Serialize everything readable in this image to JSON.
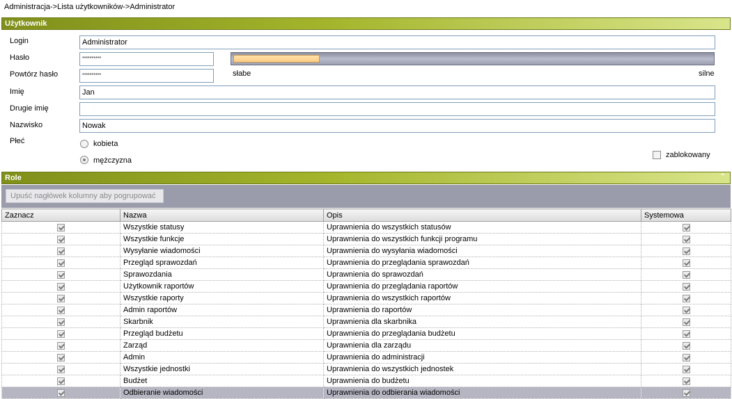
{
  "breadcrumb": "Administracja->Lista  użytkowników->Administrator",
  "user_section": {
    "title": "Użytkownik",
    "login_label": "Login",
    "login_value": "Administrator",
    "password_label": "Hasło",
    "password_value": "**********",
    "repeat_password_label": "Powtórz hasło",
    "repeat_password_value": "**********",
    "strength_weak_label": "słabe",
    "strength_strong_label": "silne",
    "strength_level": 0.18,
    "first_name_label": "Imię",
    "first_name_value": "Jan",
    "second_name_label": "Drugie imię",
    "second_name_value": "",
    "last_name_label": "Nazwisko",
    "last_name_value": "Nowak",
    "gender_label": "Płeć",
    "gender_female_label": "kobieta",
    "gender_male_label": "mężczyzna",
    "gender_selected": "male",
    "blocked_label": "zablokowany",
    "blocked_checked": false
  },
  "roles_section": {
    "title": "Role",
    "group_hint": "Upuść nagłówek kolumny aby pogrupować",
    "columns": [
      "Zaznacz",
      "Nazwa",
      "Opis",
      "Systemowa"
    ],
    "rows": [
      {
        "checked": true,
        "name": "Wszystkie statusy",
        "desc": "Uprawnienia do wszystkich statusów",
        "system": true
      },
      {
        "checked": true,
        "name": "Wszystkie funkcje",
        "desc": "Uprawnienia do wszystkich funkcji programu",
        "system": true
      },
      {
        "checked": true,
        "name": "Wysyłanie wiadomości",
        "desc": "Uprawnienia do wysyłania wiadomości",
        "system": true
      },
      {
        "checked": true,
        "name": "Przegląd sprawozdań",
        "desc": "Uprawnienia do przeglądania sprawozdań",
        "system": true
      },
      {
        "checked": true,
        "name": "Sprawozdania",
        "desc": "Uprawnienia do sprawozdań",
        "system": true
      },
      {
        "checked": true,
        "name": "Użytkownik raportów",
        "desc": "Uprawnienia do przeglądania raportów",
        "system": true
      },
      {
        "checked": true,
        "name": "Wszystkie raporty",
        "desc": "Uprawnienia do wszystkich raportów",
        "system": true
      },
      {
        "checked": true,
        "name": "Admin raportów",
        "desc": "Uprawnienia do raportów",
        "system": true
      },
      {
        "checked": true,
        "name": "Skarbnik",
        "desc": "Uprawnienia dla skarbnika",
        "system": true
      },
      {
        "checked": true,
        "name": "Przegląd budżetu",
        "desc": "Uprawnienia do przeglądania budżetu",
        "system": true
      },
      {
        "checked": true,
        "name": "Zarząd",
        "desc": "Uprawnienia dla zarządu",
        "system": true
      },
      {
        "checked": true,
        "name": "Admin",
        "desc": "Uprawnienia do administracji",
        "system": true
      },
      {
        "checked": true,
        "name": "Wszystkie jednostki",
        "desc": "Uprawnienia do wszystkich jednostek",
        "system": true
      },
      {
        "checked": true,
        "name": "Budżet",
        "desc": "Uprawnienia do budżetu",
        "system": true
      },
      {
        "checked": true,
        "name": "Odbieranie wiadomości",
        "desc": "Uprawnienia do odbierania wiadomości",
        "system": true,
        "selected": true
      }
    ]
  }
}
